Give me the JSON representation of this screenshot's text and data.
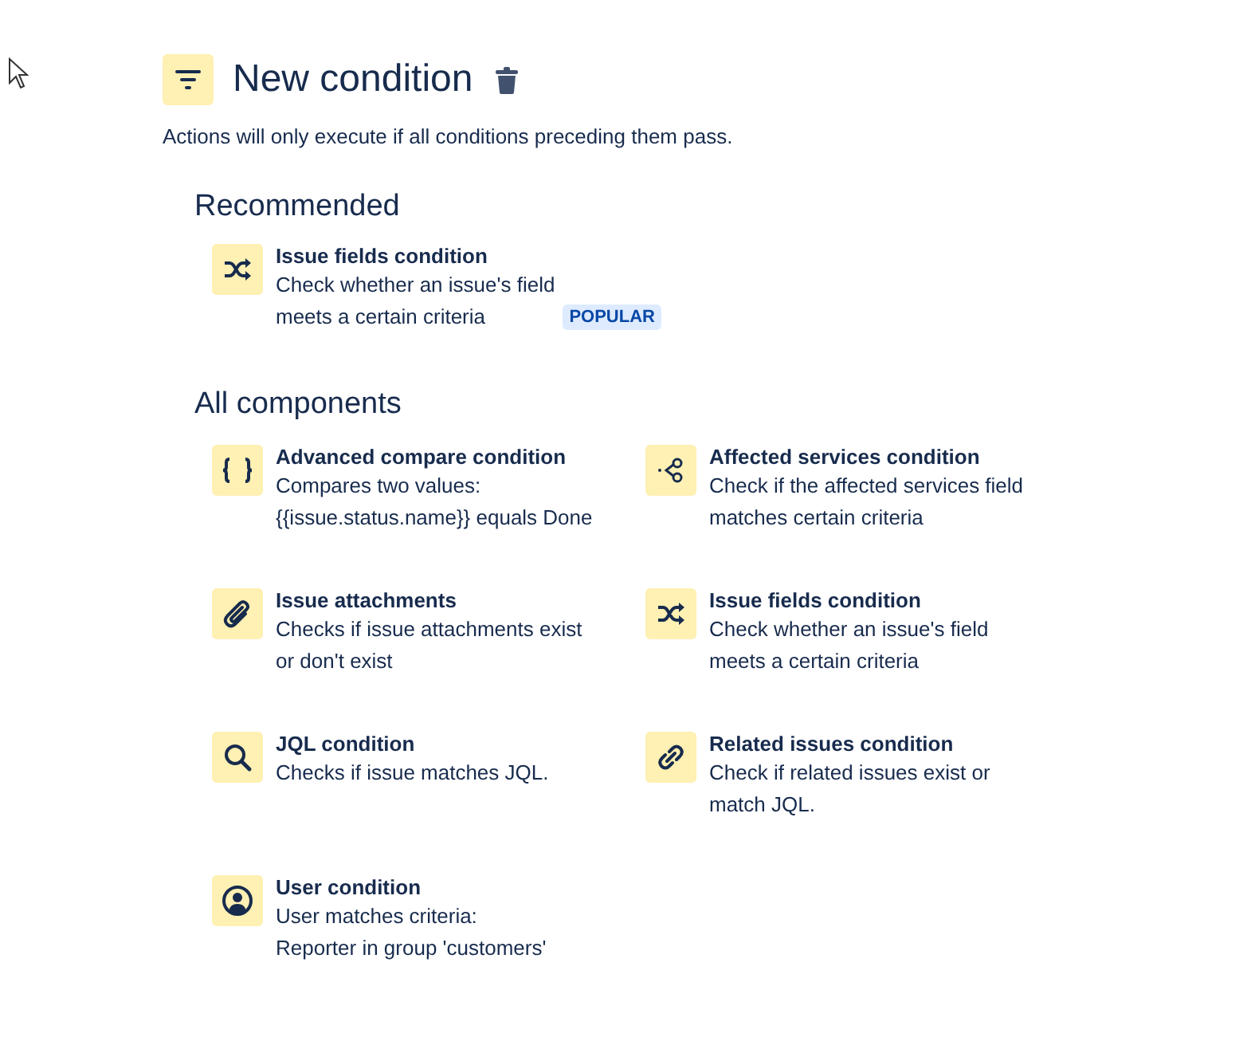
{
  "header": {
    "title": "New condition",
    "subtitle": "Actions will only execute if all conditions preceding them pass."
  },
  "sections": [
    {
      "title": "Recommended",
      "items": [
        {
          "kind": "shuffle",
          "name": "Issue fields condition",
          "lines": [
            "Check whether an issue's field",
            "meets a certain criteria"
          ],
          "badge": "POPULAR"
        }
      ]
    },
    {
      "title": "All components",
      "items": [
        {
          "kind": "braces",
          "name": "Advanced compare condition",
          "lines": [
            "Compares two values:",
            "{{issue.status.name}} equals Done"
          ]
        },
        {
          "kind": "services",
          "name": "Affected services condition",
          "lines": [
            "Check if the affected services field",
            "matches certain criteria"
          ]
        },
        {
          "kind": "paperclip",
          "name": "Issue attachments",
          "lines": [
            "Checks if issue attachments exist",
            "or don't exist"
          ]
        },
        {
          "kind": "shuffle",
          "name": "Issue fields condition",
          "lines": [
            "Check whether an issue's field",
            "meets a certain criteria"
          ]
        },
        {
          "kind": "search",
          "name": "JQL condition",
          "lines": [
            "Checks if issue matches JQL."
          ]
        },
        {
          "kind": "link",
          "name": "Related issues condition",
          "lines": [
            "Check if related issues exist or",
            "match JQL."
          ]
        },
        {
          "kind": "user",
          "name": "User condition",
          "lines": [
            "User matches criteria:",
            "Reporter in group 'customers'"
          ]
        }
      ]
    }
  ]
}
